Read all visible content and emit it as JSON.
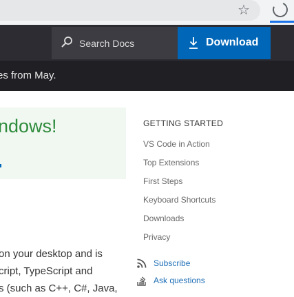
{
  "browser": {
    "bookmark_icon": "star-icon",
    "status_icon": "loading-spinner-icon"
  },
  "header": {
    "search_placeholder": "Search Docs",
    "download_label": "Download"
  },
  "banner": {
    "text": "es from May."
  },
  "hero": {
    "title": "ndows!"
  },
  "body": {
    "lines": [
      "on your desktop and is",
      "cript, TypeScript and",
      "s (such as C++, C#, Java,"
    ]
  },
  "sidebar": {
    "heading": "GETTING STARTED",
    "items": [
      {
        "label": "VS Code in Action"
      },
      {
        "label": "Top Extensions"
      },
      {
        "label": "First Steps"
      },
      {
        "label": "Keyboard Shortcuts"
      },
      {
        "label": "Downloads"
      },
      {
        "label": "Privacy"
      }
    ],
    "subscribe_label": "Subscribe",
    "ask_label": "Ask questions"
  },
  "colors": {
    "nav_bg": "#2c2c32",
    "banner_bg": "#1f1f24",
    "download_bg": "#0066b8",
    "hero_bg": "#f1f8f2",
    "hero_text": "#2e8b3c",
    "link": "#1f6fb6"
  }
}
